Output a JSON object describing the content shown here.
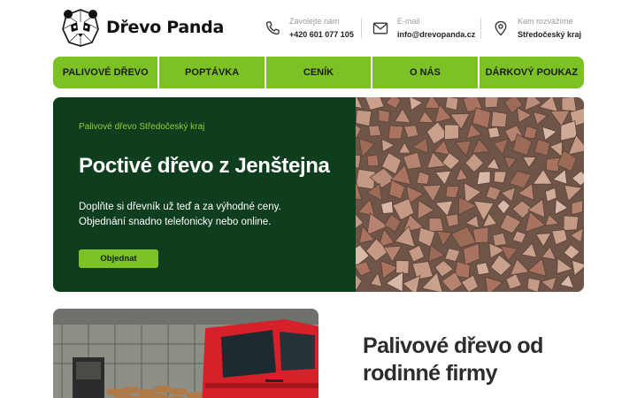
{
  "brand": {
    "name": "Dřevo Panda",
    "logo_icon": "panda-icon"
  },
  "contacts": [
    {
      "icon": "phone-icon",
      "label": "Zavolejte nám",
      "value": "+420 601 077 105"
    },
    {
      "icon": "mail-icon",
      "label": "E-mail",
      "value": "info@drevopanda.cz"
    },
    {
      "icon": "location-pin-icon",
      "label": "Kam rozvážíme",
      "value": "Středočeský kraj"
    }
  ],
  "nav": {
    "items": [
      {
        "label": "PALIVOVÉ DŘEVO"
      },
      {
        "label": "POPTÁVKA"
      },
      {
        "label": "CENÍK"
      },
      {
        "label": "O NÁS"
      },
      {
        "label": "DÁRKOVÝ POUKAZ"
      }
    ]
  },
  "hero": {
    "eyebrow": "Palivové dřevo Středočeský kraj",
    "title": "Poctivé dřevo z Jenštejna",
    "text_line1": "Doplňte si dřevník už teď a za výhodné ceny.",
    "text_line2": "Objednání snadno telefonicky nebo online.",
    "button_label": "Objednat"
  },
  "about": {
    "title_line1": "Palivové dřevo od",
    "title_line2": "rodinné firmy"
  },
  "colors": {
    "accent_green": "#7dc224",
    "hero_dark_green": "#0e3e1e",
    "eyebrow_green": "#8fd03a"
  }
}
